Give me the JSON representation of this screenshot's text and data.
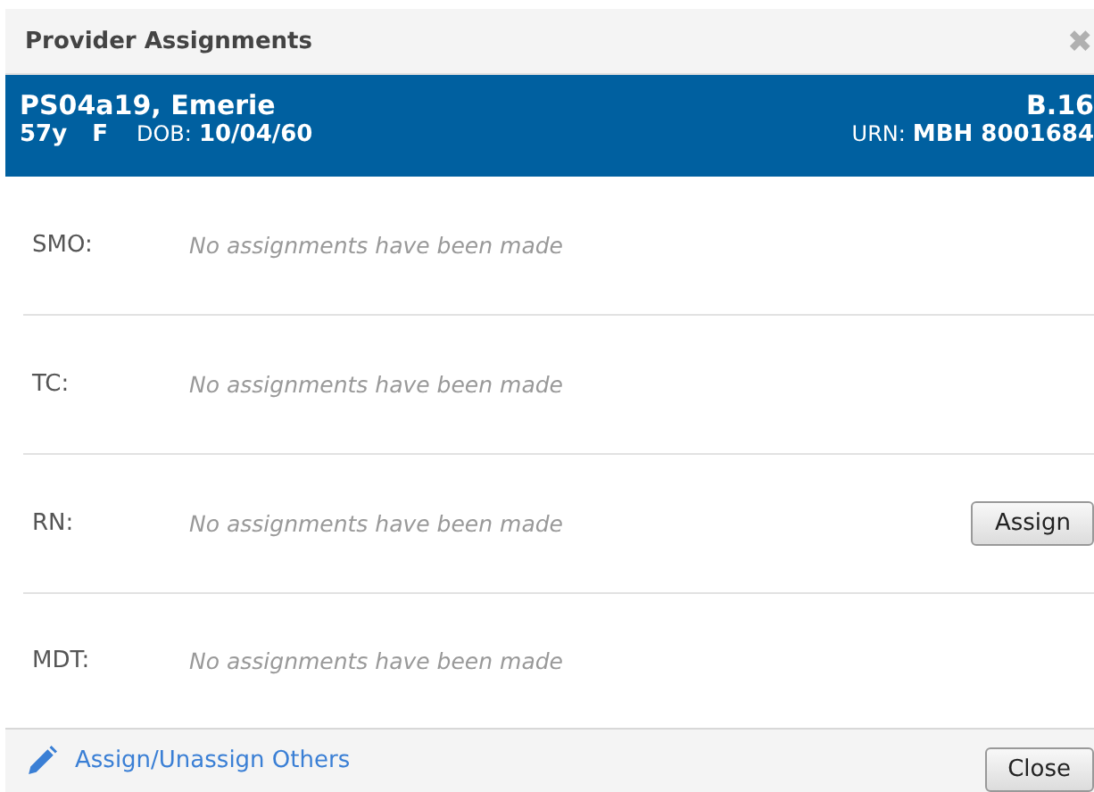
{
  "dialog": {
    "title": "Provider Assignments",
    "close_icon": "✖"
  },
  "patient": {
    "name": "PS04a19, Emerie",
    "bed": "B.16",
    "age": "57y",
    "sex": "F",
    "dob_label": "DOB:",
    "dob": "10/04/60",
    "urn_label": "URN:",
    "urn": "MBH 8001684"
  },
  "assignments": [
    {
      "role": "SMO:",
      "text": "No assignments have been made"
    },
    {
      "role": "TC:",
      "text": "No assignments have been made"
    },
    {
      "role": "RN:",
      "text": "No assignments have been made",
      "button": "Assign"
    },
    {
      "role": "MDT:",
      "text": "No assignments have been made"
    }
  ],
  "footer": {
    "link": "Assign/Unassign Others",
    "button": "Close"
  }
}
